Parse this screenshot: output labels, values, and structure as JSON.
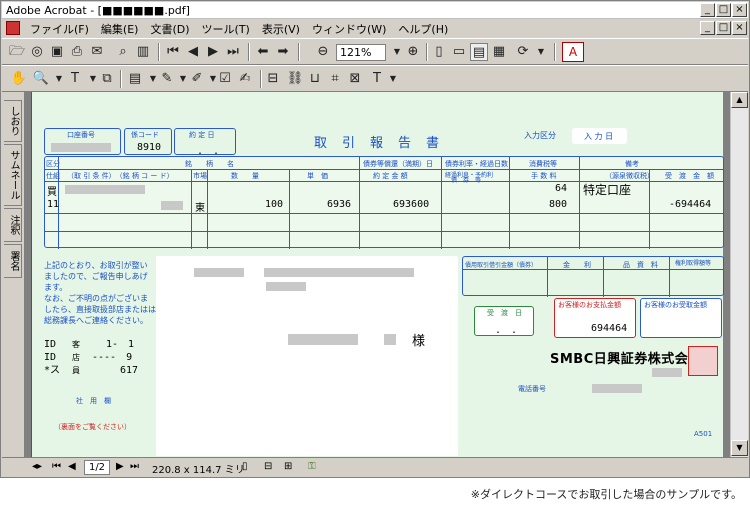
{
  "window": {
    "title": "Adobe Acrobat - [■■■■■■.pdf]"
  },
  "menu": {
    "items": [
      "ファイル(F)",
      "編集(E)",
      "文書(D)",
      "ツール(T)",
      "表示(V)",
      "ウィンドウ(W)",
      "ヘルプ(H)"
    ]
  },
  "toolbar": {
    "zoom": "121%"
  },
  "sidetabs": [
    "しおり",
    "サムネール",
    "注釈",
    "署名"
  ],
  "status": {
    "page": "1/2",
    "size": "220.8 x 114.7 ミリ"
  },
  "doc": {
    "title": "取　引　報　告　書",
    "labels": {
      "account_no": "口座番号",
      "branch_code": "係コード",
      "trade_date": "約 定 日",
      "entry_type": "入力区分",
      "entry_date": "入 力 日",
      "col_kubun": "区分",
      "col_meigara": "銘　　柄　　名",
      "col_joken": "（取 引 条 件）　（銘 柄 コ ー ド）",
      "col_shijo": "市場",
      "col_qty": "数　　量",
      "col_price": "単　価",
      "col_amount": "約 定 金 額",
      "col_accrued": "債券等償還（満期）日",
      "col_rate": "債券利率・経過日数",
      "col_fee": "手 数 料",
      "col_tax": "消費税等",
      "col_note": "備考",
      "col_note2": "（源泉徴収税）",
      "col_delivery": "受　渡　金　額",
      "col_trade": "仕組",
      "col_rate2": "経過利息・予約利",
      "col_rate3": "債　券　等",
      "sub_bond": "債用取引借引金額（債券）",
      "sub_kin": "金　　利",
      "sub_cost": "品　資　料",
      "sub_misc": "権利取得額等",
      "delivery_date": "受　渡　日",
      "pay_amount": "お客様のお支払金額",
      "recv_amount": "お客様のお受取金額",
      "phone": "電話番号",
      "postal_hint": "（裏面をご覧ください）",
      "tel_label": "社　用　欄"
    },
    "values": {
      "branch": "8910",
      "trade_date": "　.　.",
      "row1_code": "買",
      "row1_no": "11",
      "row1_market": "東",
      "row1_qty": "100",
      "row1_price": "6936",
      "row1_amount": "693600",
      "row1_tax": "64",
      "row1_fee": "800",
      "row1_note": "特定口座",
      "row1_delivery": "-694464",
      "pay_amount": "694464",
      "delivery_date": "　.　.",
      "honorific": "様",
      "company": "SMBC日興証券株式会社",
      "form_no": "A501"
    },
    "notice": [
      "上記のとおり、お取引が整い",
      "ましたので、ご報告申しあげ",
      "ます。",
      "なお、ご不明の点がございま",
      "したら、直接取扱部店またはは",
      "総務課長へご連絡ください。"
    ],
    "info": [
      {
        "k": "ID",
        "v1": "客",
        "v2": "1-　1"
      },
      {
        "k": "",
        "v1": "店",
        "v2": "----　9"
      },
      {
        "k": "*ス",
        "v1": "員",
        "v2": "617"
      }
    ]
  },
  "footnote": "※ダイレクトコースでお取引した場合のサンプルです。"
}
